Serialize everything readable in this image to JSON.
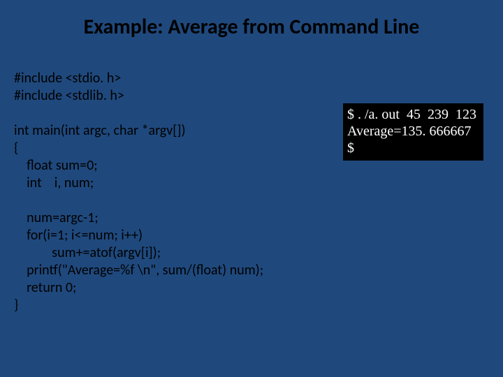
{
  "slide": {
    "title": "Example: Average from Command Line",
    "code": "#include <stdio. h>\n#include <stdlib. h>\n\nint main(int argc, char *argv[])\n{\n    float sum=0;\n    int    i, num;\n\n    num=argc-1;\n    for(i=1; i<=num; i++)\n            sum+=atof(argv[i]);\n    printf(\"Average=%f \\n\", sum/(float) num);\n    return 0;\n}",
    "terminal": "$ . /a. out  45  239  123\nAverage=135. 666667\n$"
  }
}
